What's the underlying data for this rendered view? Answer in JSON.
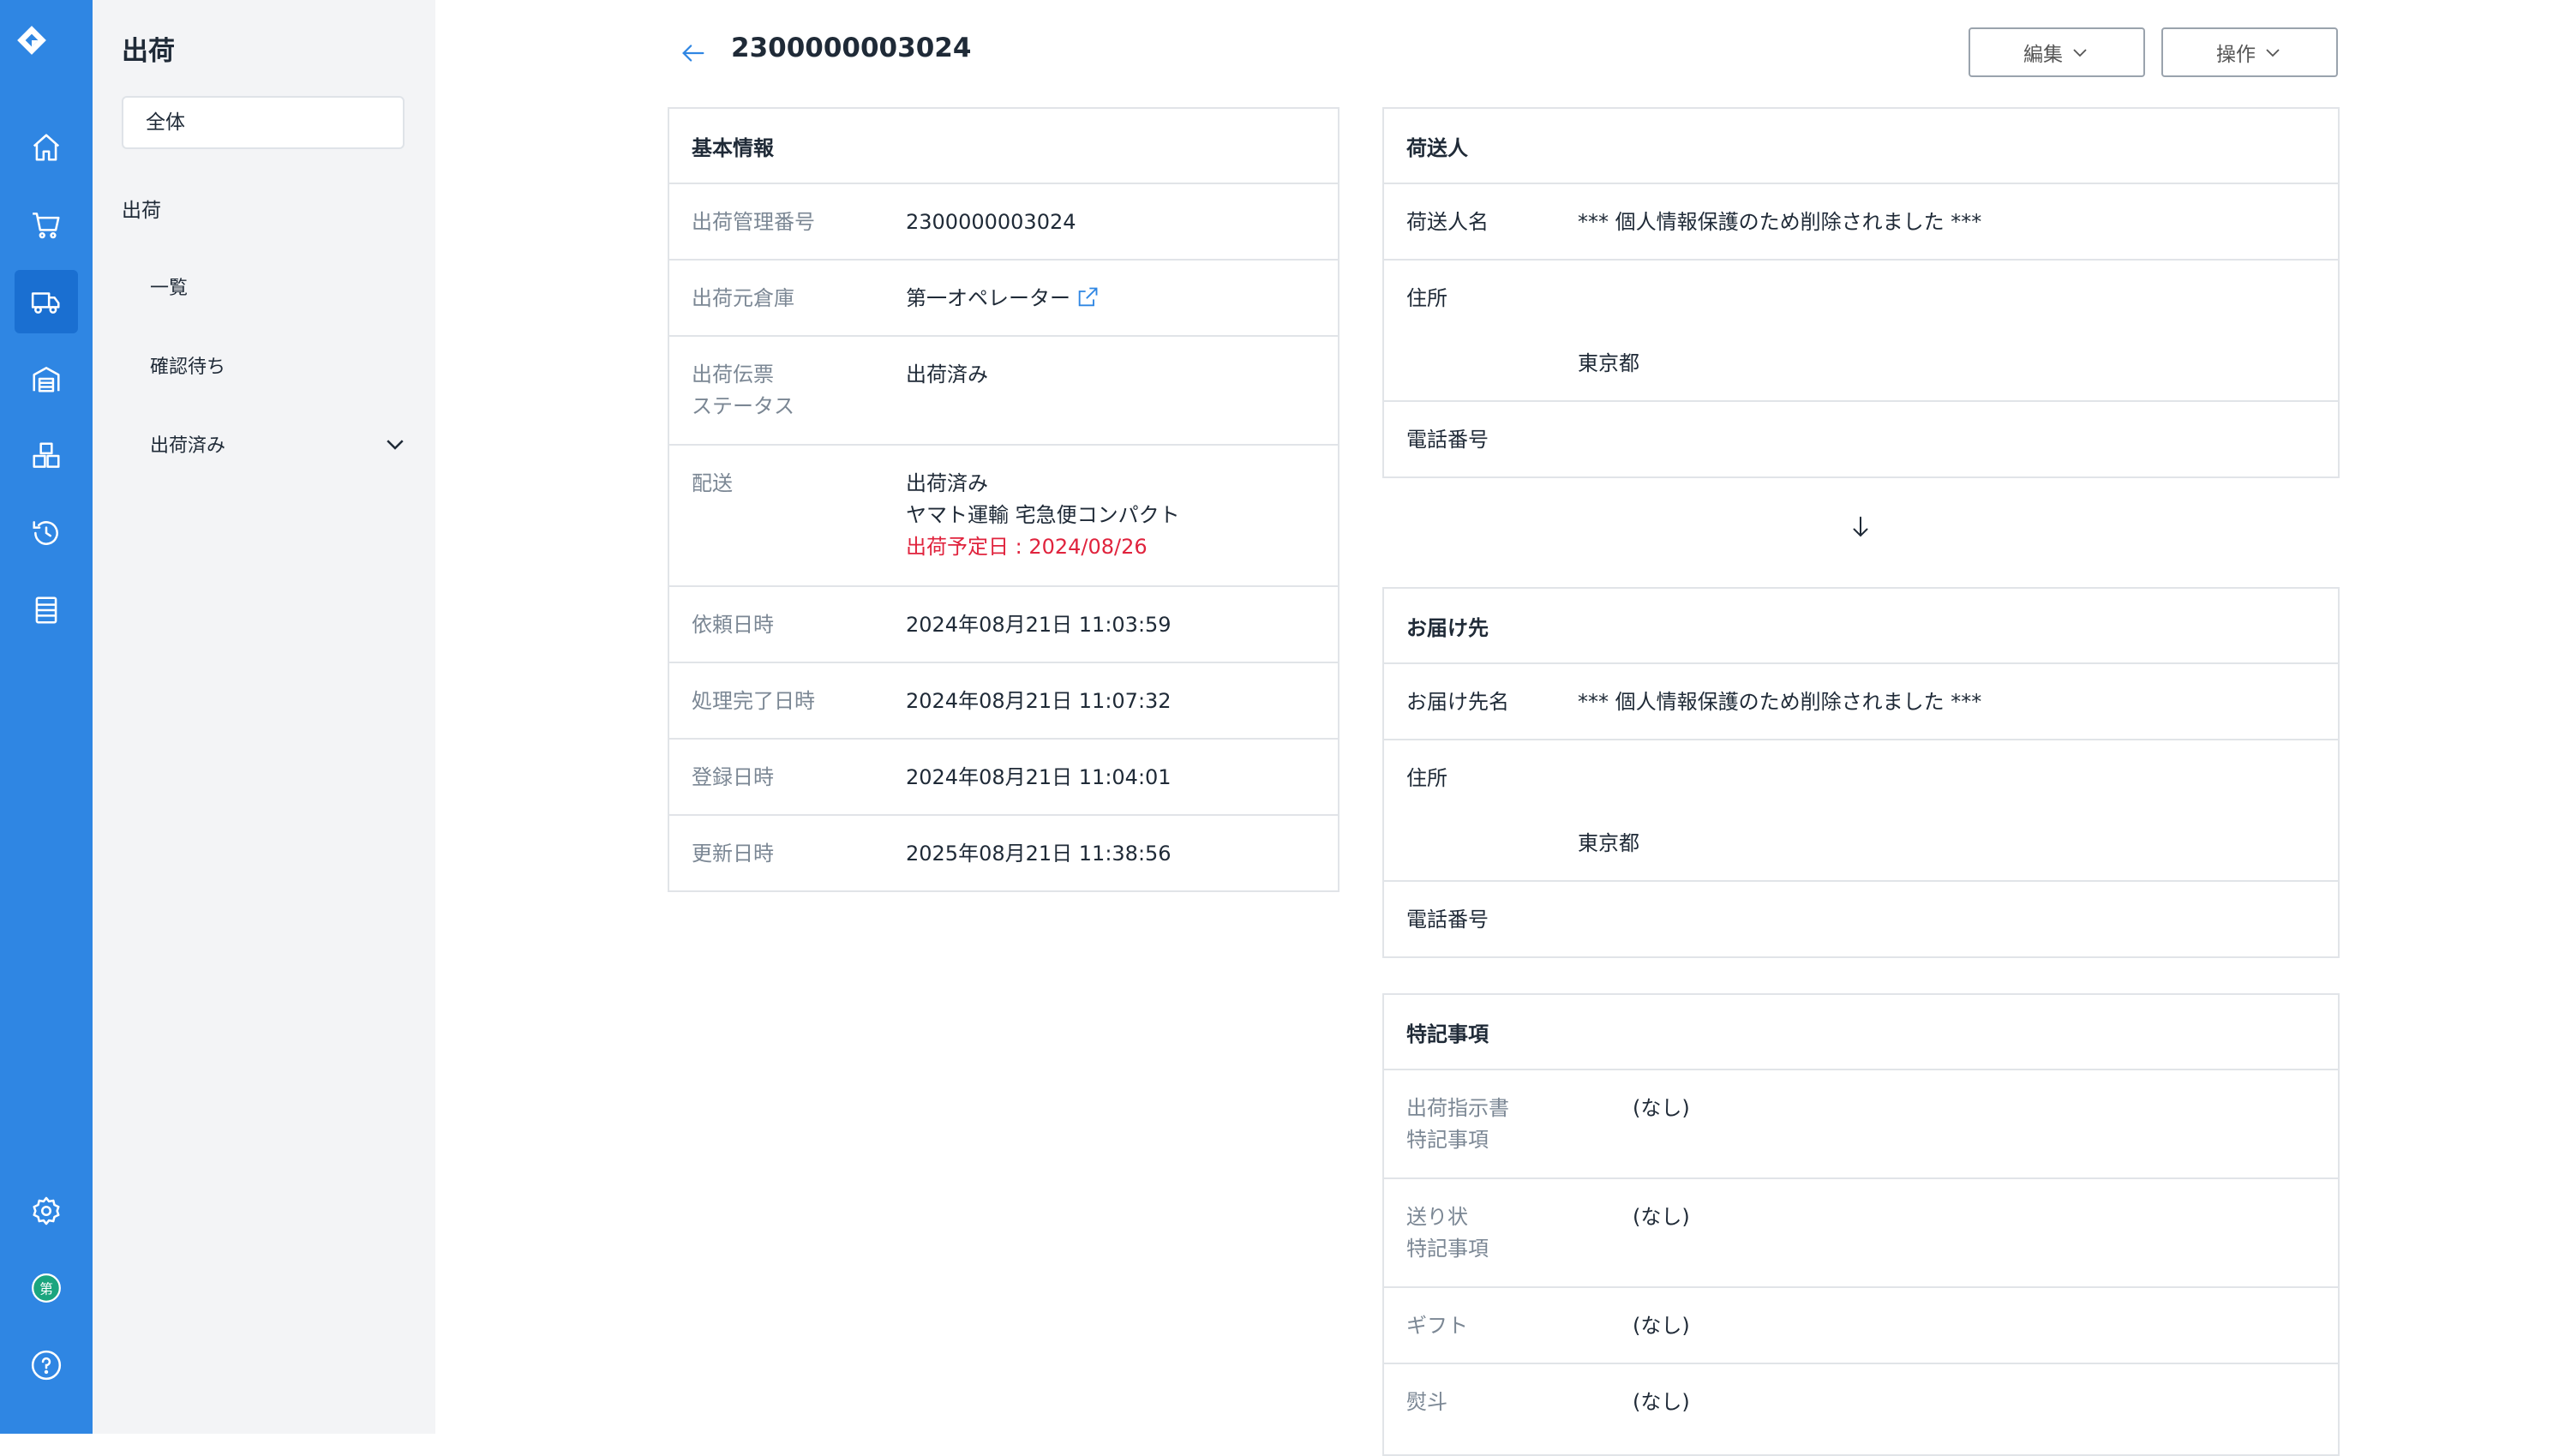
{
  "sidebar": {
    "title": "出荷",
    "all_label": "全体",
    "group_label": "出荷",
    "items": [
      {
        "label": "一覧"
      },
      {
        "label": "確認待ち"
      },
      {
        "label": "出荷済み"
      }
    ]
  },
  "rail": {
    "avatar_text": "第"
  },
  "header": {
    "title": "2300000003024",
    "edit_label": "編集",
    "action_label": "操作"
  },
  "basic_info": {
    "title": "基本情報",
    "rows": [
      {
        "label": "出荷管理番号",
        "value": "2300000003024"
      },
      {
        "label": "出荷元倉庫",
        "value": "第一オペレーター"
      },
      {
        "label": "出荷伝票",
        "label2": "ステータス",
        "value": "出荷済み"
      },
      {
        "label": "配送",
        "value": "出荷済み",
        "value2": "ヤマト運輸 宅急便コンパクト",
        "value3": "出荷予定日 : 2024/08/26"
      },
      {
        "label": "依頼日時",
        "value": "2024年08月21日 11:03:59"
      },
      {
        "label": "処理完了日時",
        "value": "2024年08月21日 11:07:32"
      },
      {
        "label": "登録日時",
        "value": "2024年08月21日 11:04:01"
      },
      {
        "label": "更新日時",
        "value": "2025年08月21日 11:38:56"
      }
    ]
  },
  "sender": {
    "title": "荷送人",
    "name_label": "荷送人名",
    "name_value": "*** 個人情報保護のため削除されました ***",
    "address_label": "住所",
    "address_value": "東京都",
    "phone_label": "電話番号"
  },
  "recipient": {
    "title": "お届け先",
    "name_label": "お届け先名",
    "name_value": "*** 個人情報保護のため削除されました ***",
    "address_label": "住所",
    "address_value": "東京都",
    "phone_label": "電話番号"
  },
  "notes": {
    "title": "特記事項",
    "rows": [
      {
        "label": "出荷指示書",
        "label2": "特記事項",
        "value": "(なし)"
      },
      {
        "label": "送り状",
        "label2": "特記事項",
        "value": "(なし)"
      },
      {
        "label": "ギフト",
        "value": "(なし)"
      },
      {
        "label": "熨斗",
        "value": "(なし)"
      }
    ]
  },
  "colors": {
    "rail": "#2f86e3",
    "rail_active": "#1a6fd1",
    "sidebar_bg": "#f3f4f6",
    "warning_text": "#e0233d",
    "avatar_green": "#1ba57e"
  },
  "icons": [
    "logo-icon",
    "home-icon",
    "cart-icon",
    "truck-icon",
    "warehouse-icon",
    "boxes-icon",
    "history-icon",
    "list-icon",
    "gear-icon",
    "avatar-icon",
    "help-icon",
    "back-arrow-icon",
    "chevron-down-icon",
    "external-link-icon",
    "arrow-down-icon"
  ]
}
